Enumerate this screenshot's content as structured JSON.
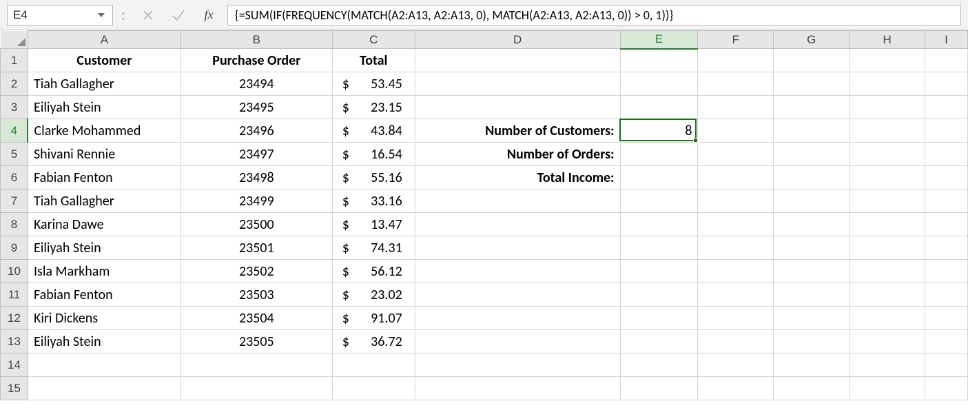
{
  "namebox": "E4",
  "formula": "{=SUM(IF(FREQUENCY(MATCH(A2:A13, A2:A13, 0), MATCH(A2:A13, A2:A13, 0)) > 0, 1))}",
  "fx_label": "fx",
  "columns": [
    "A",
    "B",
    "C",
    "D",
    "E",
    "F",
    "G",
    "H",
    "I"
  ],
  "selected_col": "E",
  "selected_row": 4,
  "rows": 15,
  "headers": {
    "A": "Customer",
    "B": "Purchase Order",
    "C": "Total"
  },
  "data_rows": [
    {
      "customer": "Tiah Gallagher",
      "po": "23494",
      "total": "53.45"
    },
    {
      "customer": "Eiliyah Stein",
      "po": "23495",
      "total": "23.15"
    },
    {
      "customer": "Clarke Mohammed",
      "po": "23496",
      "total": "43.84"
    },
    {
      "customer": "Shivani Rennie",
      "po": "23497",
      "total": "16.54"
    },
    {
      "customer": "Fabian Fenton",
      "po": "23498",
      "total": "55.16"
    },
    {
      "customer": "Tiah Gallagher",
      "po": "23499",
      "total": "33.16"
    },
    {
      "customer": "Karina Dawe",
      "po": "23500",
      "total": "13.47"
    },
    {
      "customer": "Eiliyah Stein",
      "po": "23501",
      "total": "74.31"
    },
    {
      "customer": "Isla Markham",
      "po": "23502",
      "total": "56.12"
    },
    {
      "customer": "Fabian Fenton",
      "po": "23503",
      "total": "23.02"
    },
    {
      "customer": "Kiri Dickens",
      "po": "23504",
      "total": "91.07"
    },
    {
      "customer": "Eiliyah Stein",
      "po": "23505",
      "total": "36.72"
    }
  ],
  "currency_symbol": "$",
  "side_labels": {
    "num_customers": "Number of Customers:",
    "num_orders": "Number of Orders:",
    "total_income": "Total Income:"
  },
  "side_values": {
    "num_customers": "8",
    "num_orders": "",
    "total_income": ""
  },
  "colors": {
    "accent_green": "#1d6f1d"
  }
}
